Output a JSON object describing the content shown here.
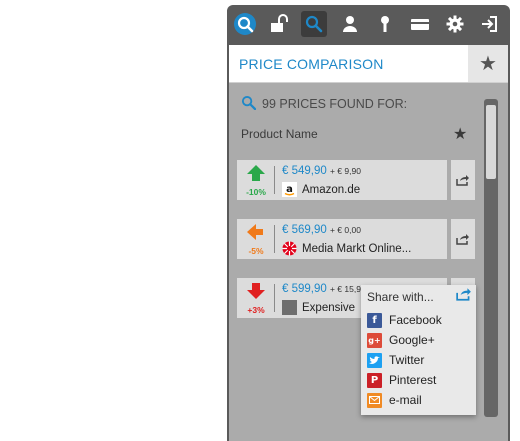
{
  "toolbar": {
    "icons": [
      "logo-icon",
      "unlock-icon",
      "search-icon",
      "user-icon",
      "key-icon",
      "card-icon",
      "gear-icon",
      "login-icon"
    ]
  },
  "header": {
    "title": "PRICE COMPARISON"
  },
  "results": {
    "found_text": "99 PRICES FOUND FOR:",
    "product_name": "Product Name"
  },
  "offers": [
    {
      "trend": "up",
      "pct": "-10%",
      "price": "€ 549,90",
      "shipping": "+ € 9,90",
      "shop": "Amazon.de"
    },
    {
      "trend": "left",
      "pct": "-5%",
      "price": "€ 569,90",
      "shipping": "+ € 0,00",
      "shop": "Media Markt Online..."
    },
    {
      "trend": "down",
      "pct": "+3%",
      "price": "€ 599,90",
      "shipping": "+ € 15,90",
      "shop": "Expensive"
    }
  ],
  "share_popup": {
    "title": "Share with...",
    "items": [
      {
        "label": "Facebook",
        "color": "#3b5998"
      },
      {
        "label": "Google+",
        "color": "#dd4b39"
      },
      {
        "label": "Twitter",
        "color": "#1da1f2"
      },
      {
        "label": "Pinterest",
        "color": "#cb2027"
      },
      {
        "label": "e-mail",
        "color": "#f08a24"
      }
    ]
  },
  "colors": {
    "accent": "#1e88c8",
    "up": "#2aa84a",
    "neutral": "#f07a1a",
    "down": "#e02020"
  }
}
